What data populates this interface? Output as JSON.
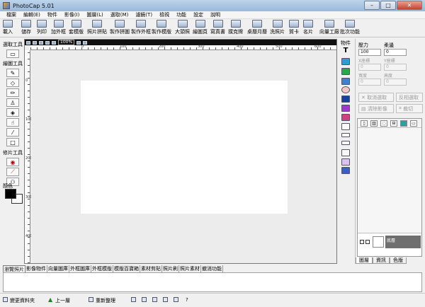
{
  "window": {
    "title": "PhotoCap 5.01",
    "minimize": "–",
    "maximize": "□",
    "close": "✕"
  },
  "menu": [
    "檔案",
    "編輯(E)",
    "物件",
    "影像(I)",
    "圖層(L)",
    "選取(M)",
    "濾鏡(T)",
    "檢視",
    "功能",
    "設定",
    "說明"
  ],
  "toolbar": [
    "載入",
    "儲存",
    "列印",
    "加外框",
    "套模版",
    "照片拼貼",
    "製作拼圖",
    "製作外框",
    "製作模版",
    "大頭照",
    "繪圖頁",
    "寫真書",
    "撲克牌",
    "桌曆月曆",
    "洗照片",
    "賀卡",
    "名片",
    "向量工廠",
    "批次功能"
  ],
  "left_panel": {
    "select_title": "選取工具",
    "draw_title": "繪圖工具",
    "retouch_title": "修片工具",
    "color_title": "顏色"
  },
  "canvas": {
    "zoom": "100%",
    "ruler_top": [
      "0",
      "100",
      "200",
      "300",
      "400",
      "500",
      "600",
      "700"
    ],
    "ruler_left": [
      "0",
      "100",
      "200",
      "300",
      "400"
    ]
  },
  "object_bar": {
    "title": "物件"
  },
  "right_panel": {
    "pressure_label": "壓力",
    "pressure_value": "100",
    "softness_label": "柔邊",
    "softness_value": "0",
    "x_label": "X座標",
    "y_label": "Y座標",
    "width_label": "寬度",
    "height_label": "高度",
    "field_placeholder": "0",
    "cancel_select": "取消選取",
    "invert_select": "反相選取",
    "clear_image": "清除影像",
    "crop": "裁切",
    "layer_name": "底層",
    "tabs": [
      "圖層",
      "資訊",
      "色版"
    ]
  },
  "doc_tabs": [
    "瀏覽照片",
    "影像物件",
    "向量圖庫",
    "外框圖庫",
    "外框模版",
    "模版百寶箱",
    "素材剪貼",
    "照片刷",
    "照片素材",
    "撤消功能"
  ],
  "statusbar": {
    "change_folder": "變更資料夾",
    "up_level": "上一層",
    "refresh": "重新整理",
    "help": "?"
  }
}
